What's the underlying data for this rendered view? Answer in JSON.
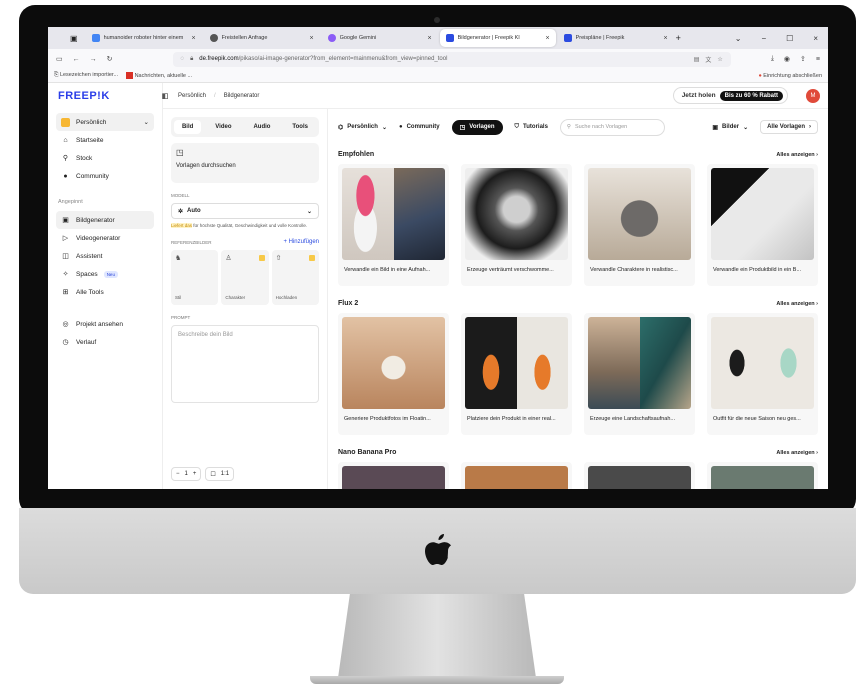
{
  "browser": {
    "tabs": [
      {
        "label": "humanoider roboter hinter einem",
        "icon_color": "#4285f4"
      },
      {
        "label": "Freistellen Anfrage",
        "icon_color": "#555555"
      },
      {
        "label": "Google Gemini",
        "icon_color": "#8b5cf6"
      },
      {
        "label": "Bildgenerator | Freepik KI",
        "icon_color": "#2b4be0",
        "active": true
      },
      {
        "label": "Preispläne | Freepik",
        "icon_color": "#2b4be0"
      }
    ],
    "url_domain": "de.freepik.com",
    "url_path": "/pikaso/ai-image-generator?from_element=mainmenu&from_view=pinned_tool",
    "bookmarks": [
      "Lesezeichen importier...",
      "Nachrichten, aktuelle ..."
    ],
    "setup_link": "Einrichtung abschließen"
  },
  "sidebar": {
    "brand": "FREEP!K",
    "workspace": "Persönlich",
    "items": [
      {
        "label": "Startseite",
        "icon": "home-icon"
      },
      {
        "label": "Stock",
        "icon": "search-icon"
      },
      {
        "label": "Community",
        "icon": "globe-icon"
      }
    ],
    "pinned_label": "Angepinnt",
    "pinned": [
      {
        "label": "Bildgenerator",
        "icon": "image-icon",
        "selected": true
      },
      {
        "label": "Videogenerator",
        "icon": "video-icon"
      },
      {
        "label": "Assistent",
        "icon": "chat-icon"
      },
      {
        "label": "Spaces",
        "icon": "spaces-icon",
        "badge": "Neu"
      },
      {
        "label": "Alle Tools",
        "icon": "grid-icon"
      }
    ],
    "footer": [
      {
        "label": "Projekt ansehen",
        "icon": "project-icon"
      },
      {
        "label": "Verlauf",
        "icon": "history-icon"
      }
    ]
  },
  "header": {
    "crumb1": "Persönlich",
    "crumb2": "Bildgenerator",
    "cta": "Jetzt holen",
    "discount": "Bis zu 60 % Rabatt",
    "avatar": "M"
  },
  "panel": {
    "modes": [
      "Bild",
      "Video",
      "Audio",
      "Tools"
    ],
    "templates": "Vorlagen durchsuchen",
    "model_label": "MODELL",
    "model_value": "Auto",
    "model_hint_hl": "Liefert das",
    "model_hint": " für höchste Qualität, Geschwindigkeit und volle Kontrolle.",
    "refs_label": "REFERENZBILDER",
    "refs_add": "+ Hinzufügen",
    "refs": [
      "Stil",
      "Charakter",
      "Hochladen"
    ],
    "prompt_label": "PROMPT",
    "prompt_placeholder": "Beschreibe dein Bild",
    "count": "1",
    "ratio": "1:1"
  },
  "main": {
    "filters": {
      "workspace": "Persönlich",
      "community": "Community",
      "templates": "Vorlagen",
      "tutorials": "Tutorials",
      "search_placeholder": "Suche nach Vorlagen",
      "type": "Bilder",
      "all": "Alle Vorlagen"
    },
    "see_all": "Alles anzeigen",
    "sections": [
      {
        "title": "Empfohlen",
        "cards": [
          "Verwandle ein Bild in eine Aufnah...",
          "Erzeuge verträumt verschwomme...",
          "Verwandle Charaktere in realistisc...",
          "Verwandle ein Produktbild in ein B..."
        ]
      },
      {
        "title": "Flux 2",
        "cards": [
          "Generiere Produktfotos im Floatin...",
          "Platziere dein Produkt in einer real...",
          "Erzeuge eine Landschaftsaufnah...",
          "Outfit für die neue Saison neu ges..."
        ]
      },
      {
        "title": "Nano Banana Pro"
      }
    ]
  }
}
